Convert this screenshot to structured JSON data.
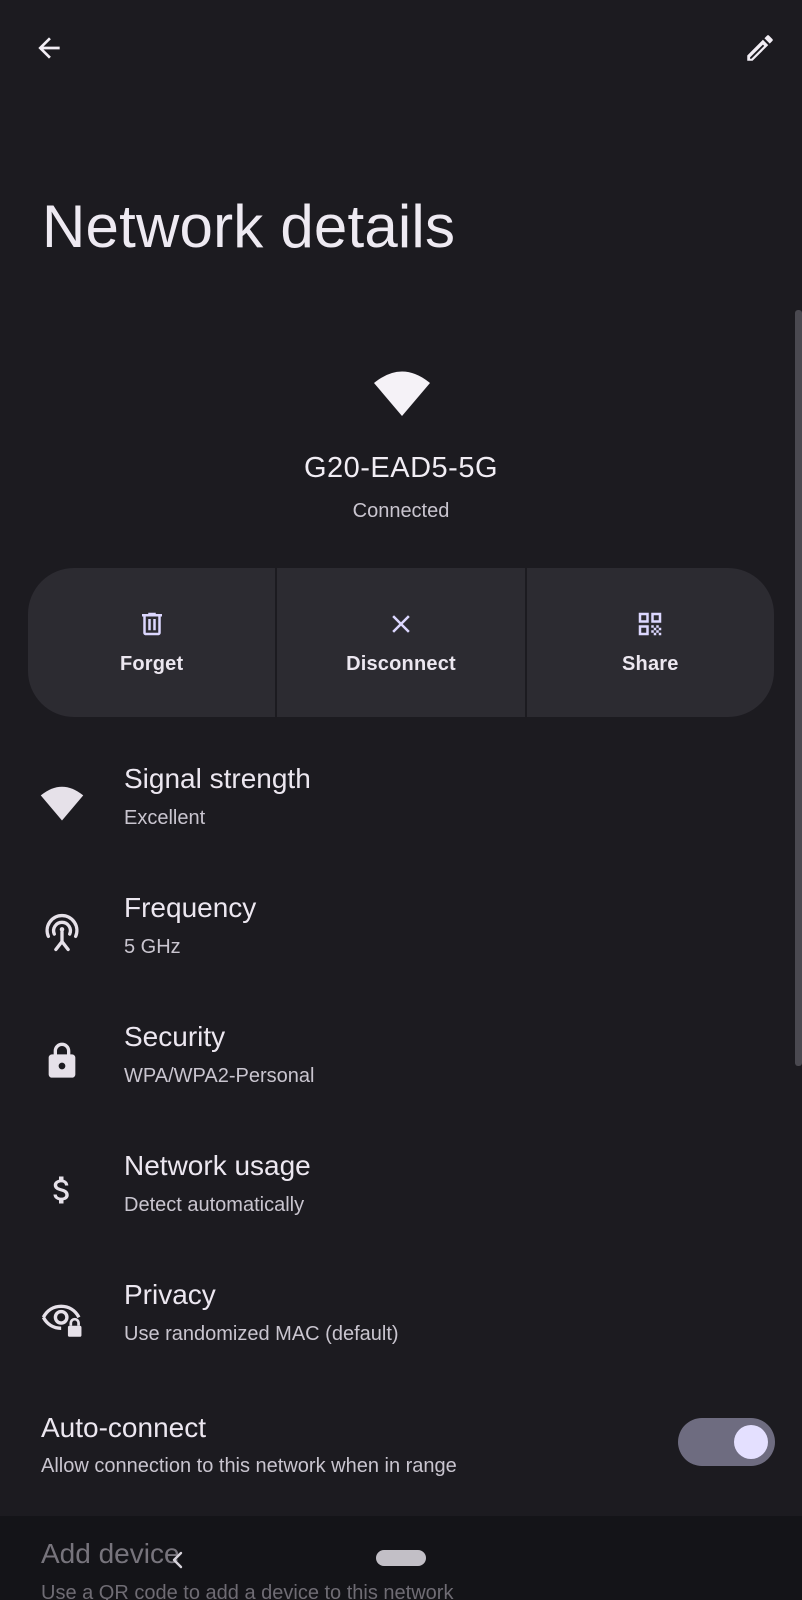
{
  "header": {
    "back_icon": "arrow-left-icon",
    "edit_icon": "pencil-icon",
    "title": "Network details"
  },
  "network": {
    "icon": "wifi-icon",
    "ssid": "G20-EAD5-5G",
    "status": "Connected"
  },
  "actions": [
    {
      "label": "Forget",
      "icon": "trash-icon"
    },
    {
      "label": "Disconnect",
      "icon": "close-icon"
    },
    {
      "label": "Share",
      "icon": "qr-code-icon"
    }
  ],
  "details": [
    {
      "title": "Signal strength",
      "value": "Excellent",
      "icon": "wifi-icon"
    },
    {
      "title": "Frequency",
      "value": "5 GHz",
      "icon": "antenna-icon"
    },
    {
      "title": "Security",
      "value": "WPA/WPA2-Personal",
      "icon": "lock-icon"
    },
    {
      "title": "Network usage",
      "value": "Detect automatically",
      "icon": "dollar-icon"
    },
    {
      "title": "Privacy",
      "value": "Use randomized MAC (default)",
      "icon": "eye-lock-icon"
    }
  ],
  "auto_connect": {
    "title": "Auto-connect",
    "subtitle": "Allow connection to this network when in range",
    "enabled": true
  },
  "add_device": {
    "title": "Add device",
    "subtitle": "Use a QR code to add a device to this network"
  },
  "colors": {
    "background": "#1c1b20",
    "card": "#2c2b31",
    "toggle_track": "#6e6c80",
    "toggle_knob": "#e4e0ff"
  }
}
